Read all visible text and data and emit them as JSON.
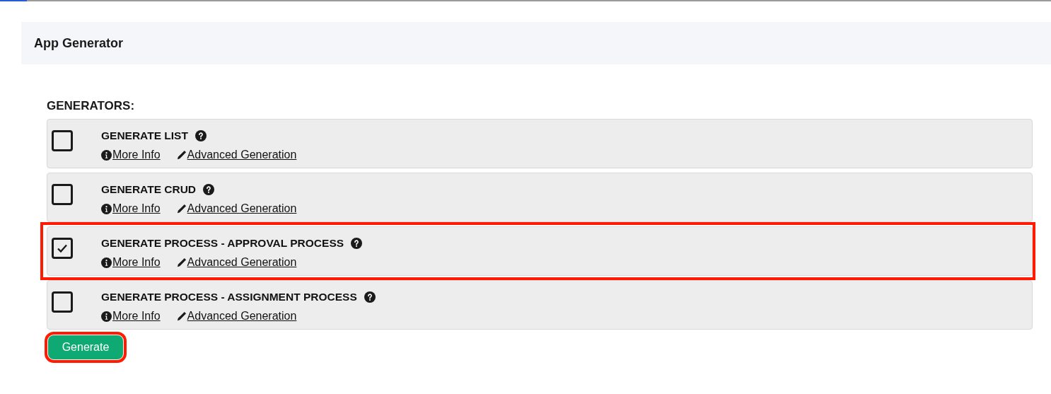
{
  "header": {
    "title": "App Generator"
  },
  "section_label": "GENERATORS:",
  "generators": [
    {
      "title": "GENERATE LIST",
      "checked": false,
      "highlighted": false,
      "links": [
        "More Info",
        "Advanced Generation"
      ]
    },
    {
      "title": "GENERATE CRUD",
      "checked": false,
      "highlighted": false,
      "links": [
        "More Info",
        "Advanced Generation"
      ]
    },
    {
      "title": "GENERATE PROCESS - APPROVAL PROCESS",
      "checked": true,
      "highlighted": true,
      "links": [
        "More Info",
        "Advanced Generation"
      ]
    },
    {
      "title": "GENERATE PROCESS - ASSIGNMENT PROCESS",
      "checked": false,
      "highlighted": false,
      "links": [
        "More Info",
        "Advanced Generation"
      ]
    }
  ],
  "generate_button": {
    "label": "Generate",
    "highlighted": true
  }
}
